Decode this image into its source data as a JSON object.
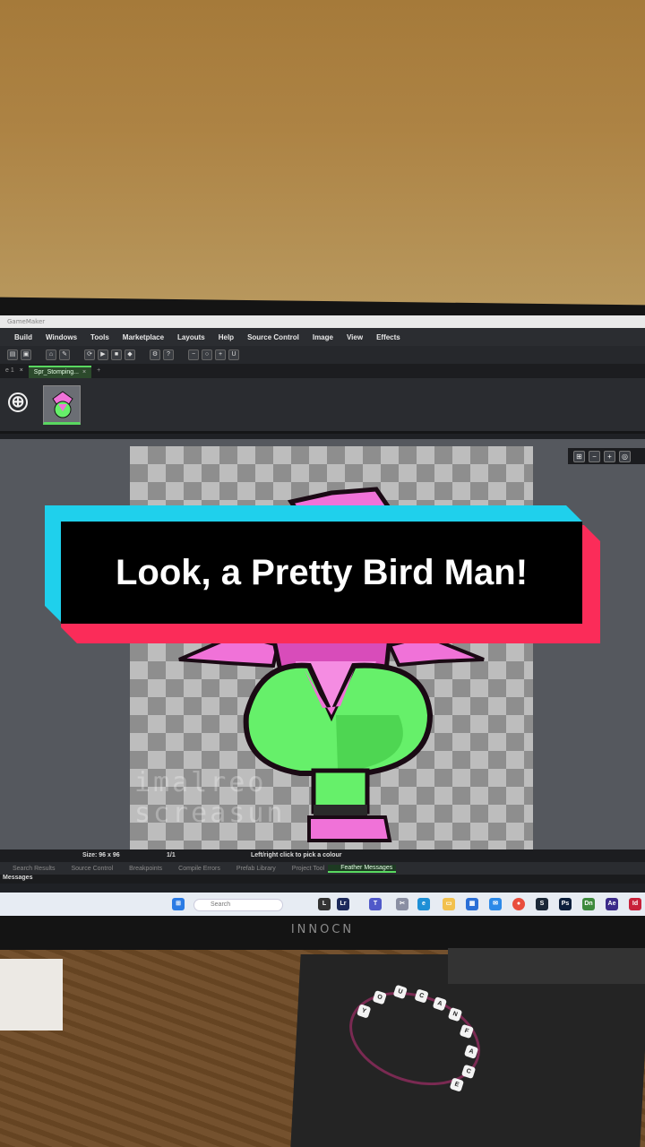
{
  "editor": {
    "menu": [
      "Build",
      "Windows",
      "Tools",
      "Marketplace",
      "Layouts",
      "Help",
      "Source Control",
      "Image",
      "View",
      "Effects"
    ],
    "sprite_tab": "Spr_Stomping...",
    "add_frame_symbol": "⊕",
    "watermark": "imalreo\nscreasun",
    "status": {
      "size": "Size: 96 x 96",
      "frame": "1/1",
      "hint": "Left/right click to pick a colour"
    },
    "bottom_tabs": [
      "Search Results",
      "Source Control",
      "Breakpoints",
      "Compile Errors",
      "Prefab Library",
      "Project Tool",
      "Feather Messages"
    ],
    "messages_label": "Messages",
    "taskbar_search": "Search"
  },
  "monitor": {
    "brand": "INNOCN"
  },
  "caption": {
    "text": "Look, a Pretty Bird Man!"
  },
  "colors": {
    "caption_cyan": "#1fd0ec",
    "caption_red": "#fb2c59",
    "sprite_green": "#66f06a",
    "sprite_pink": "#f072d8"
  }
}
